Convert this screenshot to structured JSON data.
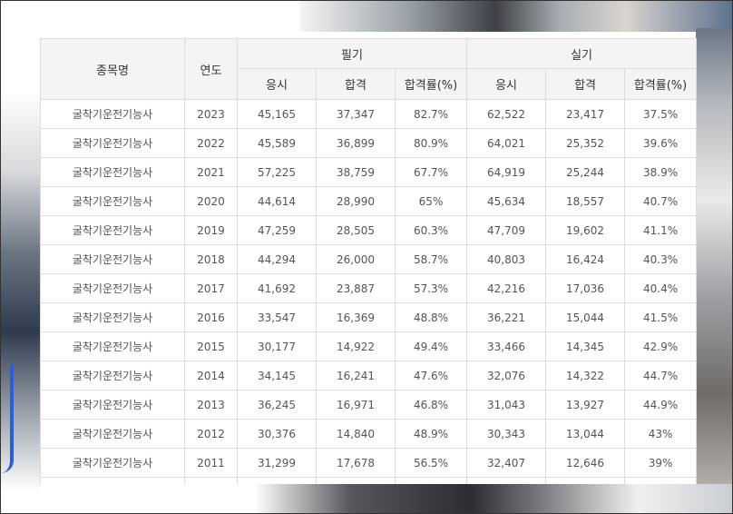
{
  "table": {
    "headers": {
      "name": "종목명",
      "year": "연도",
      "written": "필기",
      "practical": "실기",
      "sub": [
        "응시",
        "합격",
        "합격률(%)",
        "응시",
        "합격",
        "합격률(%)"
      ]
    },
    "rows": [
      [
        "굴착기운전기능사",
        "2023",
        "45,165",
        "37,347",
        "82.7%",
        "62,522",
        "23,417",
        "37.5%"
      ],
      [
        "굴착기운전기능사",
        "2022",
        "45,589",
        "36,899",
        "80.9%",
        "64,021",
        "25,352",
        "39.6%"
      ],
      [
        "굴착기운전기능사",
        "2021",
        "57,225",
        "38,759",
        "67.7%",
        "64,919",
        "25,244",
        "38.9%"
      ],
      [
        "굴착기운전기능사",
        "2020",
        "44,614",
        "28,990",
        "65%",
        "45,634",
        "18,557",
        "40.7%"
      ],
      [
        "굴착기운전기능사",
        "2019",
        "47,259",
        "28,505",
        "60.3%",
        "47,709",
        "19,602",
        "41.1%"
      ],
      [
        "굴착기운전기능사",
        "2018",
        "44,294",
        "26,000",
        "58.7%",
        "40,803",
        "16,424",
        "40.3%"
      ],
      [
        "굴착기운전기능사",
        "2017",
        "41,692",
        "23,887",
        "57.3%",
        "42,216",
        "17,036",
        "40.4%"
      ],
      [
        "굴착기운전기능사",
        "2016",
        "33,547",
        "16,369",
        "48.8%",
        "36,221",
        "15,044",
        "41.5%"
      ],
      [
        "굴착기운전기능사",
        "2015",
        "30,177",
        "14,922",
        "49.4%",
        "33,466",
        "14,345",
        "42.9%"
      ],
      [
        "굴착기운전기능사",
        "2014",
        "34,145",
        "16,241",
        "47.6%",
        "32,076",
        "14,322",
        "44.7%"
      ],
      [
        "굴착기운전기능사",
        "2013",
        "36,245",
        "16,971",
        "46.8%",
        "31,043",
        "13,927",
        "44.9%"
      ],
      [
        "굴착기운전기능사",
        "2012",
        "30,376",
        "14,840",
        "48.9%",
        "30,343",
        "13,044",
        "43%"
      ],
      [
        "굴착기운전기능사",
        "2011",
        "31,299",
        "17,678",
        "56.5%",
        "32,407",
        "12,646",
        "39%"
      ]
    ]
  },
  "colors": {
    "header_bg": "#f4f4f4",
    "border": "#dcdcdc",
    "text": "#555555"
  }
}
